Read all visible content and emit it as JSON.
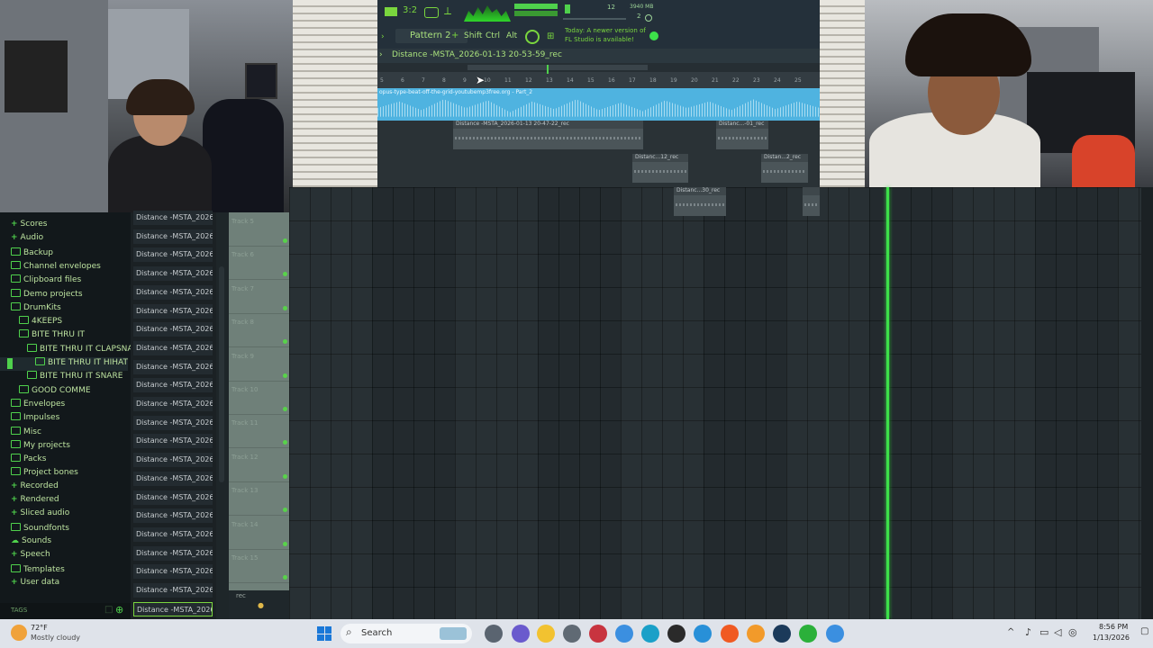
{
  "toolbar": {
    "pattern_label": "Pattern 2",
    "shift_label": "Shift",
    "ctrl_label": "Ctrl",
    "alt_label": "Alt",
    "cpu_value": "12",
    "memory_value": "3940 MB",
    "poly_value": "2",
    "news_text_line1": "Today: A newer version of",
    "news_text_line2": "FL Studio is available!",
    "tempo_display": "3:2"
  },
  "playlist": {
    "title": "Distance -MSTA_2026-01-13 20-53-59_rec",
    "ruler_numbers": [
      "5",
      "6",
      "7",
      "8",
      "9",
      "10",
      "11",
      "12",
      "13",
      "14",
      "15",
      "16",
      "17",
      "18",
      "19",
      "20",
      "21",
      "22",
      "23",
      "24",
      "25"
    ],
    "audio_clip_label": "opus-type-beat-off-the-grid-youtubemp3free.org - Part_2",
    "clips": [
      {
        "label": "Distance -MSTA_2026-01-13 20-47-22_rec"
      },
      {
        "label": "Distanc...-01_rec"
      },
      {
        "label": "Distanc...12_rec"
      },
      {
        "label": "Distan...2_rec"
      },
      {
        "label": "Distanc...30_rec"
      },
      {
        "label": ""
      }
    ]
  },
  "browser": {
    "items": [
      {
        "label": "Scores",
        "kind": "plus"
      },
      {
        "label": "Audio",
        "kind": "plus"
      },
      {
        "label": "Backup",
        "kind": "folder"
      },
      {
        "label": "Channel envelopes",
        "kind": "folder"
      },
      {
        "label": "Clipboard files",
        "kind": "folder"
      },
      {
        "label": "Demo projects",
        "kind": "folder"
      },
      {
        "label": "DrumKits",
        "kind": "folder"
      },
      {
        "label": "4KEEPS",
        "kind": "folder"
      },
      {
        "label": "BITE THRU IT",
        "kind": "folder"
      },
      {
        "label": "BITE THRU IT CLAPSNARE",
        "kind": "folder"
      },
      {
        "label": "BITE THRU IT HIHAT",
        "kind": "folder"
      },
      {
        "label": "BITE THRU IT SNARE",
        "kind": "folder"
      },
      {
        "label": "GOOD COMME",
        "kind": "folder"
      },
      {
        "label": "Envelopes",
        "kind": "folder"
      },
      {
        "label": "Impulses",
        "kind": "folder"
      },
      {
        "label": "Misc",
        "kind": "folder"
      },
      {
        "label": "My projects",
        "kind": "folder"
      },
      {
        "label": "Packs",
        "kind": "folder"
      },
      {
        "label": "Project bones",
        "kind": "folder"
      },
      {
        "label": "Recorded",
        "kind": "plus"
      },
      {
        "label": "Rendered",
        "kind": "plus"
      },
      {
        "label": "Sliced audio",
        "kind": "plus"
      },
      {
        "label": "Soundfonts",
        "kind": "folder"
      },
      {
        "label": "Sounds",
        "kind": "cloud"
      },
      {
        "label": "Speech",
        "kind": "plus"
      },
      {
        "label": "Templates",
        "kind": "folder"
      },
      {
        "label": "User data",
        "kind": "plus"
      }
    ],
    "tags_label": "TAGS"
  },
  "tracklist": {
    "row_label": "Distance -MSTA_2026-01...",
    "row_count": 22
  },
  "track_headers": [
    "Track 5",
    "Track 6",
    "Track 7",
    "Track 8",
    "Track 9",
    "Track 10",
    "Track 11",
    "Track 12",
    "Track 13",
    "Track 14",
    "Track 15"
  ],
  "rec_label": "rec",
  "taskbar": {
    "weather_temp": "72°F",
    "weather_desc": "Mostly cloudy",
    "search_label": "Search",
    "time": "8:56 PM",
    "date": "1/13/2026"
  },
  "colors": {
    "accent_green": "#3de04a",
    "audio_clip": "#4fb3e0",
    "browser_text": "#bde3a0"
  }
}
